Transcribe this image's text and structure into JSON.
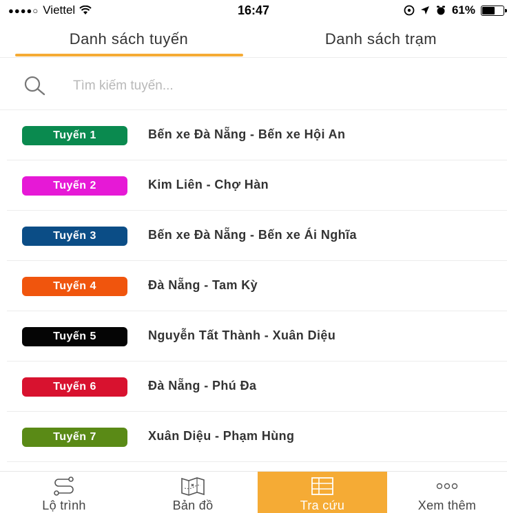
{
  "status_bar": {
    "signal": "●●●●○",
    "carrier": "Viettel",
    "time": "16:47",
    "battery": "61%",
    "battery_level": 0.61
  },
  "tabs": [
    {
      "label": "Danh sách tuyến",
      "active": true
    },
    {
      "label": "Danh sách trạm",
      "active": false
    }
  ],
  "search": {
    "placeholder": "Tìm kiếm tuyến...",
    "value": ""
  },
  "routes": [
    {
      "badge": "Tuyến 1",
      "name": "Bến xe Đà Nẵng - Bến xe Hội An",
      "color": "#0a8a4f"
    },
    {
      "badge": "Tuyến 2",
      "name": "Kim Liên - Chợ Hàn",
      "color": "#e619d6"
    },
    {
      "badge": "Tuyến 3",
      "name": "Bến xe Đà Nẵng - Bến xe Ái Nghĩa",
      "color": "#0b4d86"
    },
    {
      "badge": "Tuyến 4",
      "name": "Đà Nẵng - Tam Kỳ",
      "color": "#f0550d"
    },
    {
      "badge": "Tuyến 5",
      "name": "Nguyễn Tất Thành - Xuân Diệu",
      "color": "#050505"
    },
    {
      "badge": "Tuyến 6",
      "name": "Đà Nẵng - Phú Đa",
      "color": "#d8122f"
    },
    {
      "badge": "Tuyến 7",
      "name": "Xuân Diệu - Phạm Hùng",
      "color": "#5a8a16"
    }
  ],
  "bottom_nav": [
    {
      "label": "Lộ trình",
      "icon": "route-icon"
    },
    {
      "label": "Bản đồ",
      "icon": "map-icon"
    },
    {
      "label": "Tra cứu",
      "icon": "table-icon",
      "active": true
    },
    {
      "label": "Xem thêm",
      "icon": "more-icon"
    }
  ],
  "colors": {
    "accent": "#f5ab35",
    "divider": "#ececec"
  }
}
